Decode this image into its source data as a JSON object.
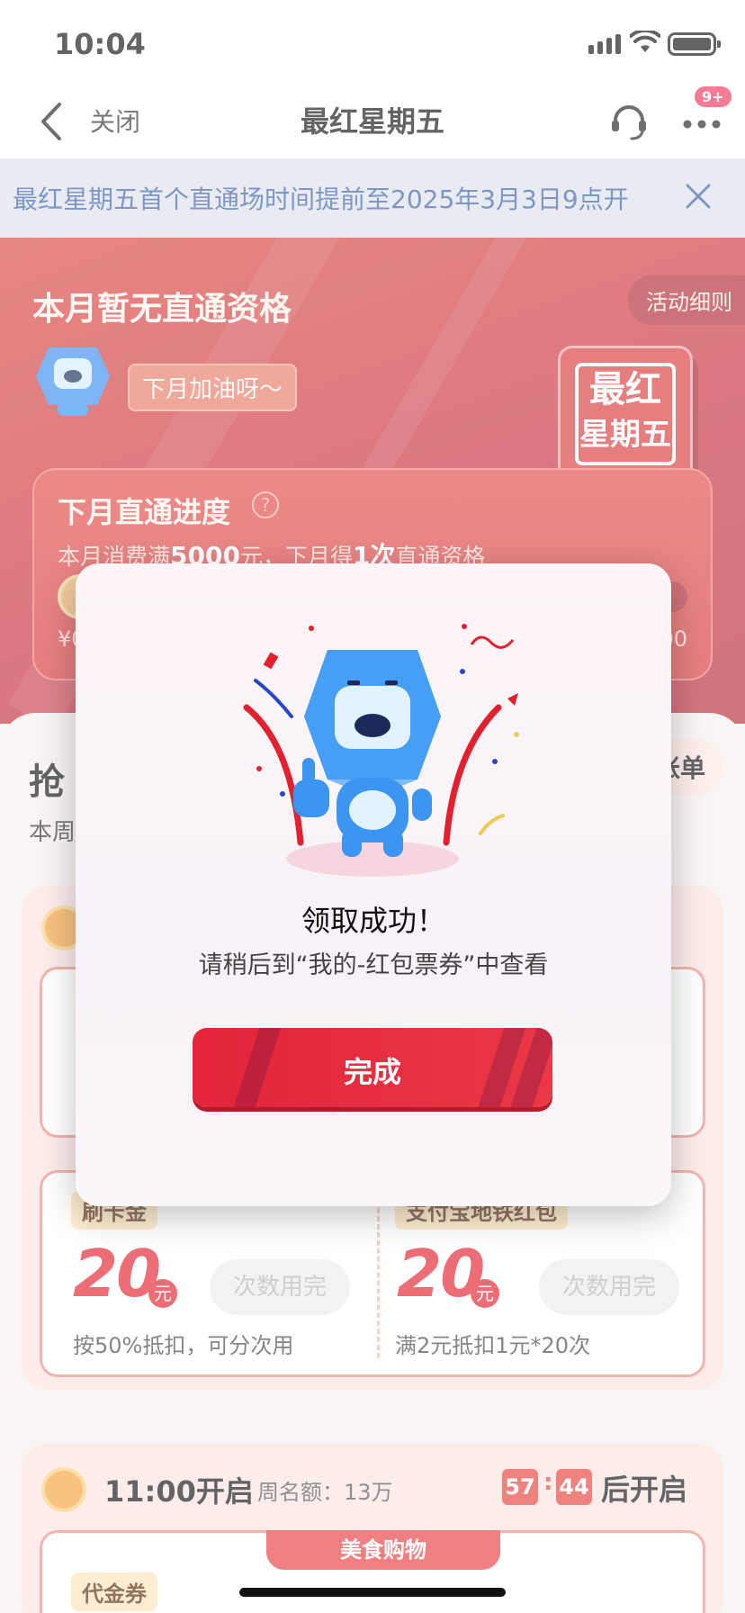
{
  "status": {
    "time": "10:04"
  },
  "nav": {
    "close_label": "关闭",
    "title": "最红星期五",
    "badge": "9+"
  },
  "notice": {
    "text": "最红星期五首个直通场时间提前至2025年3月3日9点开"
  },
  "hero": {
    "title": "本月暂无直通资格",
    "rules_label": "活动细则",
    "cheer": "下月加油呀～",
    "brand_line1": "最红",
    "brand_line2": "星期五",
    "progress": {
      "title": "下月直通进度",
      "desc_pre": "本月消费满",
      "desc_amount": "5000",
      "desc_mid": "元，下月得",
      "desc_times": "1次",
      "desc_post": "直通资格",
      "min_label": "¥0",
      "max_label": "00",
      "fraction": 0.0
    }
  },
  "section": {
    "title": "抢",
    "subtitle": "本周",
    "bill_label": "账单"
  },
  "slot1": {
    "coupons": [
      {
        "tag": "刷卡金",
        "amount": "20",
        "unit": "元",
        "status": "次数用完",
        "note": "按50%抵扣，可分次用"
      },
      {
        "tag": "支付宝地铁红包",
        "amount": "20",
        "unit": "元",
        "status": "次数用完",
        "note": "满2元抵扣1元*20次"
      }
    ]
  },
  "slot2": {
    "title": "11:00开启",
    "quota": "周名额：13万",
    "countdown_min": "57",
    "countdown_sec": "44",
    "countdown_suffix": "后开启",
    "tab_label": "美食购物",
    "coupon_tag": "代金券"
  },
  "modal": {
    "title": "领取成功！",
    "subtitle": "请稍后到“我的-红包票券”中查看",
    "button_label": "完成"
  },
  "colors": {
    "brand_red": "#e3243a",
    "notice_blue": "#3a5ea8",
    "hero_red": "#c8303e"
  }
}
